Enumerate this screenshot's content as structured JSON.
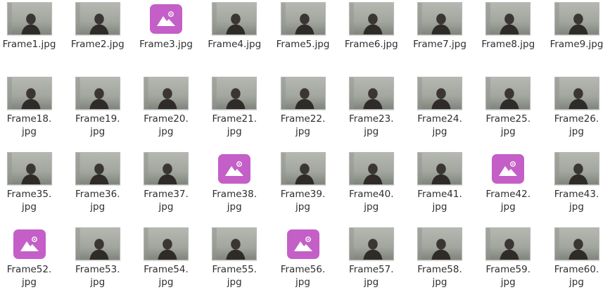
{
  "colors": {
    "placeholder_icon_bg": "#c45fc8",
    "label_text": "#2e2e2e",
    "background": "#ffffff"
  },
  "rows": [
    {
      "files": [
        {
          "name": "Frame1.jpg",
          "thumb": "photo"
        },
        {
          "name": "Frame2.jpg",
          "thumb": "photo"
        },
        {
          "name": "Frame3.jpg",
          "thumb": "image-placeholder-icon"
        },
        {
          "name": "Frame4.jpg",
          "thumb": "photo"
        },
        {
          "name": "Frame5.jpg",
          "thumb": "photo"
        },
        {
          "name": "Frame6.jpg",
          "thumb": "photo"
        },
        {
          "name": "Frame7.jpg",
          "thumb": "photo"
        },
        {
          "name": "Frame8.jpg",
          "thumb": "photo"
        },
        {
          "name": "Frame9.jpg",
          "thumb": "photo"
        }
      ]
    },
    {
      "files": [
        {
          "name": "Frame18.\njpg",
          "thumb": "photo"
        },
        {
          "name": "Frame19.\njpg",
          "thumb": "photo"
        },
        {
          "name": "Frame20.\njpg",
          "thumb": "photo"
        },
        {
          "name": "Frame21.\njpg",
          "thumb": "photo"
        },
        {
          "name": "Frame22.\njpg",
          "thumb": "photo"
        },
        {
          "name": "Frame23.\njpg",
          "thumb": "photo"
        },
        {
          "name": "Frame24.\njpg",
          "thumb": "photo"
        },
        {
          "name": "Frame25.\njpg",
          "thumb": "photo"
        },
        {
          "name": "Frame26.\njpg",
          "thumb": "photo"
        }
      ]
    },
    {
      "files": [
        {
          "name": "Frame35.\njpg",
          "thumb": "photo"
        },
        {
          "name": "Frame36.\njpg",
          "thumb": "photo"
        },
        {
          "name": "Frame37.\njpg",
          "thumb": "photo"
        },
        {
          "name": "Frame38.\njpg",
          "thumb": "image-placeholder-icon"
        },
        {
          "name": "Frame39.\njpg",
          "thumb": "photo"
        },
        {
          "name": "Frame40.\njpg",
          "thumb": "photo"
        },
        {
          "name": "Frame41.\njpg",
          "thumb": "photo"
        },
        {
          "name": "Frame42.\njpg",
          "thumb": "image-placeholder-icon"
        },
        {
          "name": "Frame43.\njpg",
          "thumb": "photo"
        }
      ]
    },
    {
      "files": [
        {
          "name": "Frame52.\njpg",
          "thumb": "image-placeholder-icon"
        },
        {
          "name": "Frame53.\njpg",
          "thumb": "photo"
        },
        {
          "name": "Frame54.\njpg",
          "thumb": "photo"
        },
        {
          "name": "Frame55.\njpg",
          "thumb": "photo"
        },
        {
          "name": "Frame56.\njpg",
          "thumb": "image-placeholder-icon"
        },
        {
          "name": "Frame57.\njpg",
          "thumb": "photo"
        },
        {
          "name": "Frame58.\njpg",
          "thumb": "photo"
        },
        {
          "name": "Frame59.\njpg",
          "thumb": "photo"
        },
        {
          "name": "Frame60.\njpg",
          "thumb": "photo"
        }
      ]
    }
  ]
}
